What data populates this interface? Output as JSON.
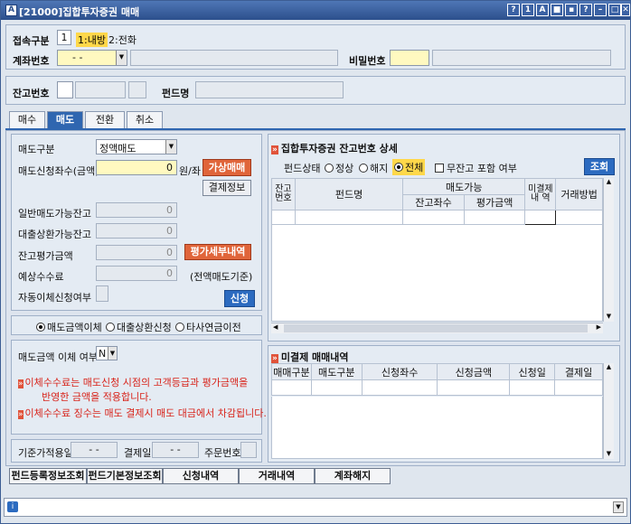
{
  "window": {
    "title": "[21000]집합투자증권 매매",
    "icon": "A"
  },
  "title_buttons": [
    "?",
    "1",
    "A",
    "■",
    "▪",
    "?",
    "–",
    "□",
    "✕"
  ],
  "connect": {
    "label": "접속구분",
    "value": "1",
    "opt1": "1:내방",
    "opt2": "2:전화"
  },
  "account": {
    "label": "계좌번호",
    "value": "-        -",
    "password_label": "비밀번호"
  },
  "balance": {
    "label": "잔고번호",
    "fund_label": "펀드명"
  },
  "tabs": [
    "매수",
    "매도",
    "전환",
    "취소"
  ],
  "sell": {
    "type_label": "매도구분",
    "type_value": "정액매도",
    "amount_label": "매도신청좌수(금액)",
    "amount_value": "0",
    "amount_unit": "원/좌",
    "virtual_btn": "가상매매",
    "settle_btn": "결제정보",
    "general_label": "일반매도가능잔고",
    "general_value": "0",
    "loan_label": "대출상환가능잔고",
    "loan_value": "0",
    "eval_label": "잔고평가금액",
    "eval_value": "0",
    "eval_btn": "평가세부내역",
    "fee_label": "예상수수료",
    "fee_value": "0",
    "fee_note": "(전액매도기준)",
    "auto_label": "자동이체신청여부",
    "apply_btn": "신청"
  },
  "radio_group": [
    "매도금액이체",
    "대출상환신청",
    "타사연금이전"
  ],
  "transfer": {
    "label": "매도금액 이체 여부",
    "value": "N",
    "notice1a": "이체수수료는 매도신청 시점의 고객등급과 평가금액을",
    "notice1b": "반영한 금액을 적용합니다.",
    "notice2": "이체수수료 징수는 매도 결제시 매도 대금에서 차감됩니다."
  },
  "dates": {
    "base_label": "기준가적용일",
    "base_value": "-  -",
    "settle_label": "결제일",
    "settle_value": "-  -",
    "order_label": "주문번호"
  },
  "detail": {
    "title": "집합투자증권 잔고번호 상세",
    "status_label": "펀드상태",
    "status_opts": [
      "정상",
      "해지",
      "전체"
    ],
    "zero_label": "무잔고 포함 여부",
    "search_btn": "조회",
    "cols": {
      "balno": "잔고\n번호",
      "fund": "펀드명",
      "sellable": "매도가능",
      "qty": "잔고좌수",
      "eval": "평가금액",
      "unsettled": "미결제\n내 역",
      "method": "거래방법"
    }
  },
  "unsettled": {
    "title": "미결제 매매내역",
    "cols": [
      "매매구분",
      "매도구분",
      "신청좌수",
      "신청금액",
      "신청일",
      "결제일"
    ]
  },
  "bottom_buttons": [
    "펀드등록정보조회",
    "펀드기본정보조회",
    "신청내역",
    "거래내역",
    "계좌해지"
  ],
  "status_icon": "info-icon",
  "colors": {
    "accent": "#2f66b0",
    "title": "#2c4f8c",
    "red": "#e0653a",
    "yellow": "#fff9c0"
  }
}
